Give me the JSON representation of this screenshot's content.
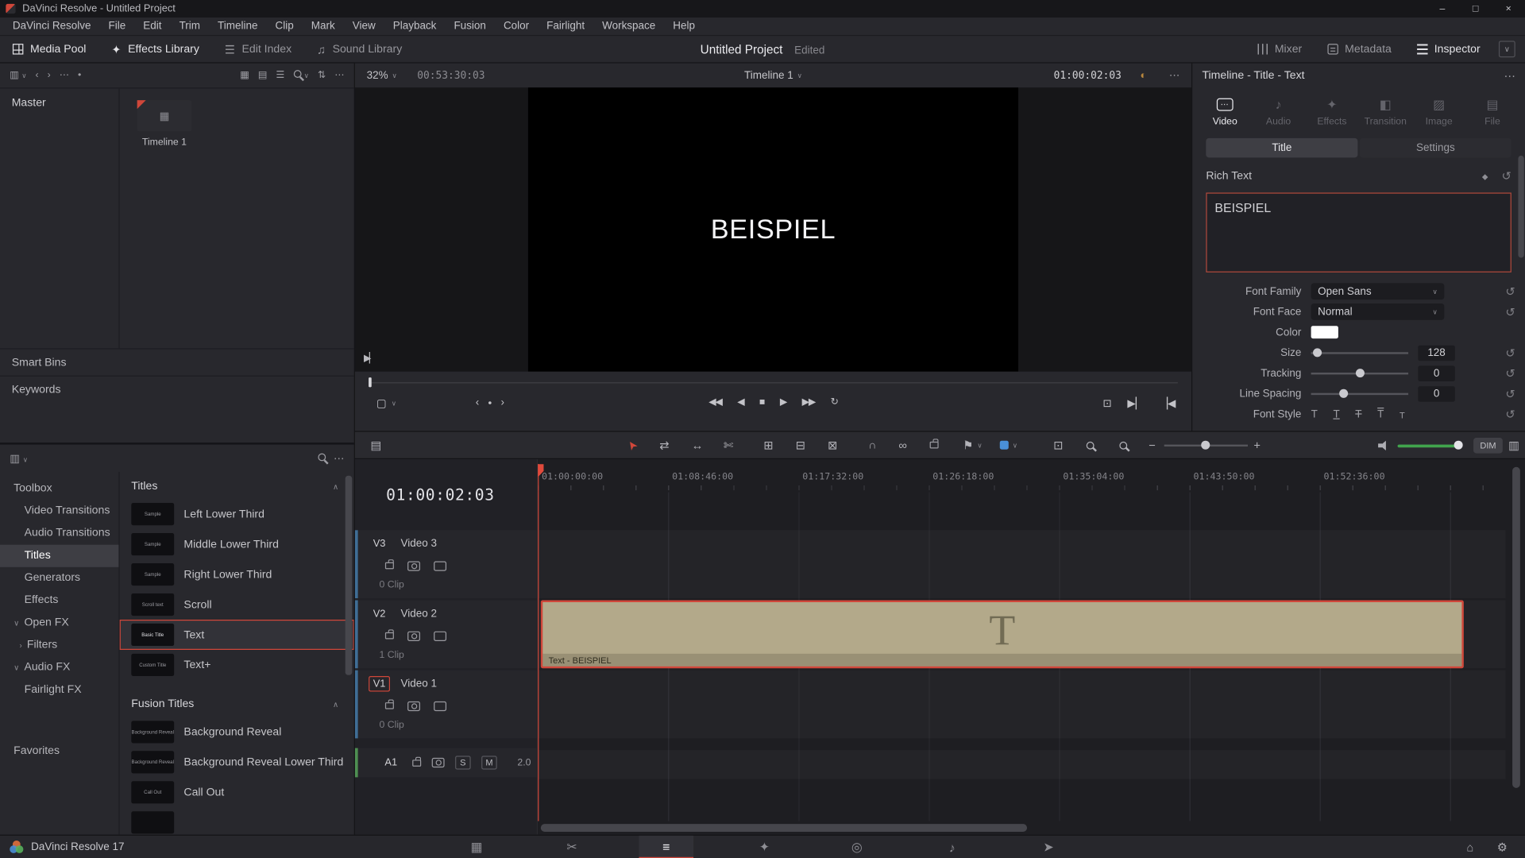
{
  "titlebar": {
    "title": "DaVinci Resolve - Untitled Project"
  },
  "menu": {
    "items": [
      "DaVinci Resolve",
      "File",
      "Edit",
      "Trim",
      "Timeline",
      "Clip",
      "Mark",
      "View",
      "Playback",
      "Fusion",
      "Color",
      "Fairlight",
      "Workspace",
      "Help"
    ]
  },
  "topbar": {
    "media_pool": "Media Pool",
    "effects_library": "Effects Library",
    "edit_index": "Edit Index",
    "sound_library": "Sound Library",
    "project_title": "Untitled Project",
    "project_status": "Edited",
    "mixer": "Mixer",
    "metadata": "Metadata",
    "inspector": "Inspector"
  },
  "media_pool": {
    "bin": "Master",
    "clip_name": "Timeline 1",
    "smart_bins": "Smart Bins",
    "keywords": "Keywords"
  },
  "effects": {
    "nav": [
      "Toolbox",
      "Video Transitions",
      "Audio Transitions",
      "Titles",
      "Generators",
      "Effects",
      "Open FX",
      "Filters",
      "Audio FX",
      "Fairlight FX",
      "Favorites"
    ],
    "titles_header": "Titles",
    "titles": [
      {
        "thumb": "Sample",
        "label": "Left Lower Third"
      },
      {
        "thumb": "Sample",
        "label": "Middle Lower Third"
      },
      {
        "thumb": "Sample",
        "label": "Right Lower Third"
      },
      {
        "thumb": "Scroll text",
        "label": "Scroll"
      },
      {
        "thumb": "Basic Title",
        "label": "Text"
      },
      {
        "thumb": "Custom Title",
        "label": "Text+"
      }
    ],
    "fusion_header": "Fusion Titles",
    "fusion_titles": [
      {
        "thumb": "Background Reveal",
        "label": "Background Reveal"
      },
      {
        "thumb": "Background Reveal",
        "label": "Background Reveal Lower Third"
      },
      {
        "thumb": "Call Out",
        "label": "Call Out"
      }
    ]
  },
  "viewer": {
    "zoom": "32%",
    "clip_timecode": "00:53:30:03",
    "timeline_name": "Timeline 1",
    "timecode": "01:00:02:03",
    "canvas_text": "BEISPIEL"
  },
  "inspector": {
    "header": "Timeline - Title - Text",
    "tabs": [
      "Video",
      "Audio",
      "Effects",
      "Transition",
      "Image",
      "File"
    ],
    "active_tab": "Video",
    "subtab_title": "Title",
    "subtab_settings": "Settings",
    "rich_text_label": "Rich Text",
    "text_value": "BEISPIEL",
    "rows": {
      "font_family_label": "Font Family",
      "font_family_value": "Open Sans",
      "font_face_label": "Font Face",
      "font_face_value": "Normal",
      "color_label": "Color",
      "color_value": "#ffffff",
      "size_label": "Size",
      "size_value": "128",
      "tracking_label": "Tracking",
      "tracking_value": "0",
      "line_spacing_label": "Line Spacing",
      "line_spacing_value": "0",
      "font_style_label": "Font Style"
    }
  },
  "timeline_toolbar": {
    "dim": "DIM"
  },
  "timeline": {
    "timecode": "01:00:02:03",
    "ruler": [
      "01:00:00:00",
      "01:08:46:00",
      "01:17:32:00",
      "01:26:18:00",
      "01:35:04:00",
      "01:43:50:00",
      "01:52:36:00"
    ],
    "tracks": [
      {
        "id": "V3",
        "name": "Video 3",
        "count": "0 Clip"
      },
      {
        "id": "V2",
        "name": "Video 2",
        "count": "1 Clip"
      },
      {
        "id": "V1",
        "name": "Video 1",
        "count": "0 Clip"
      }
    ],
    "audio": {
      "id": "A1",
      "solo": "S",
      "mute": "M",
      "channels": "2.0"
    },
    "clip_label": "Text - BEISPIEL",
    "clip_glyph": "T"
  },
  "statusbar": {
    "app": "DaVinci Resolve 17",
    "pages": [
      "media",
      "cut",
      "edit",
      "fusion",
      "color",
      "fairlight",
      "deliver"
    ],
    "active_page": "edit"
  },
  "colors": {
    "accent": "#d0473a",
    "clip": "#b3a98a",
    "green": "#41a44d",
    "blue": "#4a90d8"
  }
}
